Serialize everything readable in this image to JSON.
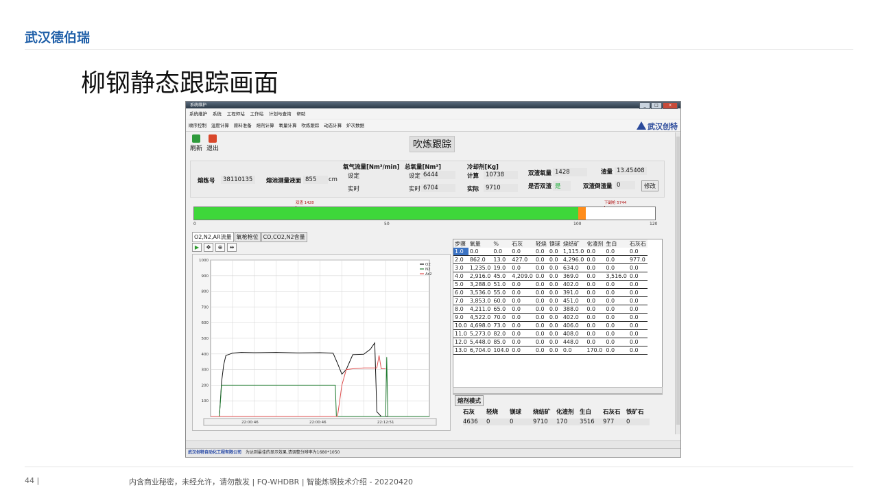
{
  "slide": {
    "brand": "武汉德伯瑞",
    "title": "柳钢静态跟踪画面",
    "page_number": "44 |",
    "footer": "内含商业秘密，未经允许，请勿散发 | FQ-WHDBR | 智能炼钢技术介绍 - 20220420"
  },
  "app": {
    "window_title": "系统维护",
    "menu": [
      "系统维护",
      "系统",
      "工程师站",
      "工作站",
      "计划与查询",
      "帮助"
    ],
    "nav": [
      "顺序控制",
      "温度计算",
      "原料准备",
      "熔剂计算",
      "氧量计算",
      "吹炼跟踪",
      "动态计算",
      "炉次数据"
    ],
    "logo": "武汉创特",
    "toolbar": {
      "refresh": "刷新",
      "exit": "退出"
    },
    "page_heading": "吹炼跟踪",
    "info": {
      "heat_label": "熔炼号",
      "heat_value": "38110135",
      "bath_label": "熔池测量液面",
      "bath_value": "855",
      "bath_unit": "cm",
      "oxygen_flow_label": "氧气流量[Nm³/min]",
      "set_label": "设定",
      "actual_label": "实时",
      "total_oxygen_label": "总氧量[Nm³]",
      "total_set_label": "设定",
      "total_set_value": "6444",
      "total_actual_label": "实时",
      "total_actual_value": "6704",
      "coolant_label": "冷却剂[Kg]",
      "calc_label": "计算",
      "calc_value": "10738",
      "real_label": "实际",
      "real_value": "9710",
      "dual_oxygen_label": "双渣氧量",
      "dual_oxygen_value": "1428",
      "dual_slag_label": "是否双渣",
      "dual_slag_value": "是",
      "slag_label": "渣量",
      "slag_value": "13.45408",
      "dual_dump_label": "双渣倒渣量",
      "dual_dump_value": "0",
      "edit_button": "修改"
    },
    "progress": {
      "fraction": 0.8333,
      "tail_fraction": 0.0167,
      "marker1": "双渣 1428",
      "marker1_pos": 0.2216,
      "marker2": "下副枪 5744",
      "marker2_pos": 0.8914,
      "ticks": [
        "0",
        "50",
        "100",
        "120"
      ]
    },
    "tabs": [
      "O2,N2,AR流量",
      "氧枪枪位",
      "CO,CO2,N2含量"
    ],
    "chart_data": {
      "type": "line",
      "ylim": [
        0,
        1000
      ],
      "y_ticks": [
        "1000",
        "900",
        "800",
        "700",
        "600",
        "500",
        "400",
        "300",
        "200",
        "100"
      ],
      "x_ticks": [
        "22:00:46",
        "22:00:46",
        "22:12:51"
      ],
      "series": [
        {
          "name": "O2",
          "color": "#111111",
          "x": [
            0,
            0.04,
            0.05,
            0.06,
            0.07,
            0.1,
            0.14,
            0.2,
            0.3,
            0.4,
            0.5,
            0.56,
            0.58,
            0.6,
            0.62,
            0.65,
            0.7,
            0.73,
            0.75,
            0.76,
            0.78,
            0.8,
            0.82,
            0.83,
            0.84,
            1.0
          ],
          "y": [
            0,
            0,
            220,
            330,
            390,
            405,
            410,
            408,
            410,
            406,
            408,
            405,
            340,
            270,
            300,
            395,
            398,
            430,
            470,
            30,
            0,
            0,
            0,
            0,
            0,
            0
          ]
        },
        {
          "name": "N2",
          "color": "#1e7a2e",
          "x": [
            0,
            0.04,
            0.05,
            0.2,
            0.4,
            0.56,
            0.57,
            0.575,
            0.8,
            0.805,
            0.81,
            1.0
          ],
          "y": [
            0,
            0,
            200,
            200,
            200,
            200,
            200,
            0,
            0,
            380,
            0,
            0
          ]
        },
        {
          "name": "Ar2",
          "color": "#e05050",
          "x": [
            0,
            0.58,
            0.6,
            0.62,
            0.65,
            0.7,
            0.76,
            0.77,
            0.78,
            0.8
          ],
          "y": [
            0,
            0,
            200,
            300,
            305,
            310,
            310,
            390,
            305,
            305
          ]
        }
      ]
    },
    "table": {
      "headers": [
        "步骤",
        "氧量",
        "%",
        "石灰",
        "轻烧",
        "镁球",
        "烧结矿",
        "化渣剂",
        "生白",
        "石灰石"
      ],
      "rows": [
        [
          "1.0",
          "0.0",
          "0.0",
          "0.0",
          "0.0",
          "0.0",
          "1,115.0",
          "0.0",
          "0.0",
          "0.0"
        ],
        [
          "2.0",
          "862.0",
          "13.0",
          "427.0",
          "0.0",
          "0.0",
          "4,296.0",
          "0.0",
          "0.0",
          "977.0"
        ],
        [
          "3.0",
          "1,235.0",
          "19.0",
          "0.0",
          "0.0",
          "0.0",
          "634.0",
          "0.0",
          "0.0",
          "0.0"
        ],
        [
          "4.0",
          "2,916.0",
          "45.0",
          "4,209.0",
          "0.0",
          "0.0",
          "369.0",
          "0.0",
          "3,516.0",
          "0.0"
        ],
        [
          "5.0",
          "3,288.0",
          "51.0",
          "0.0",
          "0.0",
          "0.0",
          "402.0",
          "0.0",
          "0.0",
          "0.0"
        ],
        [
          "6.0",
          "3,536.0",
          "55.0",
          "0.0",
          "0.0",
          "0.0",
          "391.0",
          "0.0",
          "0.0",
          "0.0"
        ],
        [
          "7.0",
          "3,853.0",
          "60.0",
          "0.0",
          "0.0",
          "0.0",
          "451.0",
          "0.0",
          "0.0",
          "0.0"
        ],
        [
          "8.0",
          "4,211.0",
          "65.0",
          "0.0",
          "0.0",
          "0.0",
          "388.0",
          "0.0",
          "0.0",
          "0.0"
        ],
        [
          "9.0",
          "4,522.0",
          "70.0",
          "0.0",
          "0.0",
          "0.0",
          "402.0",
          "0.0",
          "0.0",
          "0.0"
        ],
        [
          "10.0",
          "4,698.0",
          "73.0",
          "0.0",
          "0.0",
          "0.0",
          "406.0",
          "0.0",
          "0.0",
          "0.0"
        ],
        [
          "11.0",
          "5,273.0",
          "82.0",
          "0.0",
          "0.0",
          "0.0",
          "408.0",
          "0.0",
          "0.0",
          "0.0"
        ],
        [
          "12.0",
          "5,448.0",
          "85.0",
          "0.0",
          "0.0",
          "0.0",
          "448.0",
          "0.0",
          "0.0",
          "0.0"
        ],
        [
          "13.0",
          "6,704.0",
          "104.0",
          "0.0",
          "0.0",
          "0.0",
          "0.0",
          "170.0",
          "0.0",
          "0.0"
        ]
      ]
    },
    "mode_button": "熔剂模式",
    "summary": {
      "headers": [
        "石灰",
        "轻烧",
        "镁球",
        "烧结矿",
        "化渣剂",
        "生白",
        "石灰石",
        "铁矿石"
      ],
      "values": [
        "4636",
        "0",
        "0",
        "9710",
        "170",
        "3516",
        "977",
        "0"
      ]
    },
    "status": [
      "武汉创特自动化工程有限公司",
      "为达到最佳的显示效果,请调整分辨率为1680*1050"
    ]
  }
}
